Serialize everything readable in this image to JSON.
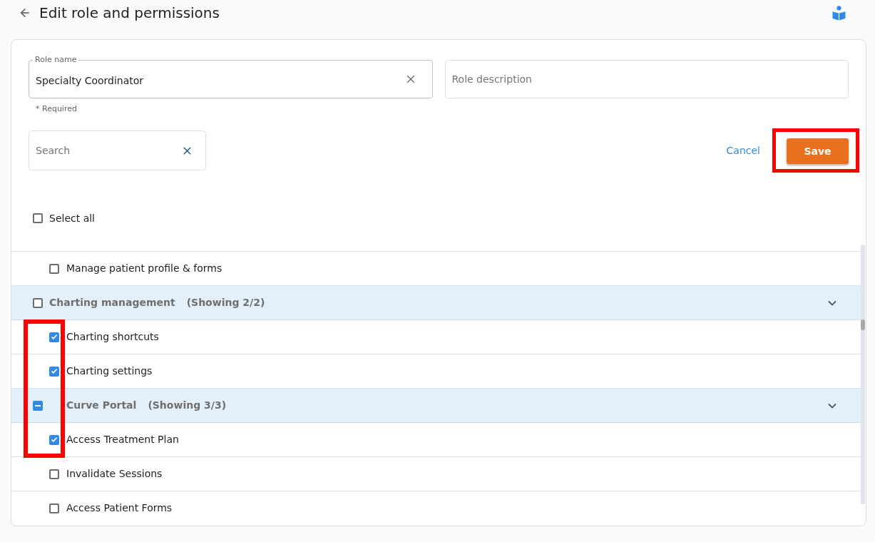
{
  "header": {
    "title": "Edit role and permissions"
  },
  "role_name": {
    "label": "Role name",
    "value": "Specialty Coordinator",
    "helper": "* Required"
  },
  "role_description": {
    "placeholder": "Role description"
  },
  "search": {
    "placeholder": "Search"
  },
  "cancel": {
    "label": "Cancel"
  },
  "save": {
    "label": "Save",
    "highlighted": true
  },
  "select_all": {
    "label": "Select all",
    "checked": false
  },
  "groups": [
    {
      "children": [
        {
          "label": "Manage patient profile & forms",
          "checked": false,
          "highlighted": false
        }
      ]
    },
    {
      "label": "Charting management",
      "count": "(Showing 2/2)",
      "checked": false,
      "indeterminate": false,
      "expanded": true,
      "highlighted": false,
      "children": [
        {
          "label": "Charting shortcuts",
          "checked": true,
          "highlighted": true
        },
        {
          "label": "Charting settings",
          "checked": true,
          "highlighted": true
        }
      ]
    },
    {
      "label": "Curve Portal",
      "count": "(Showing 3/3)",
      "indeterminate": true,
      "expanded": true,
      "highlighted": true,
      "children": [
        {
          "label": "Access Treatment Plan",
          "checked": true,
          "highlighted": true
        },
        {
          "label": "Invalidate Sessions",
          "checked": false,
          "highlighted": false
        },
        {
          "label": "Access Patient Forms",
          "checked": false,
          "highlighted": false
        }
      ]
    }
  ]
}
